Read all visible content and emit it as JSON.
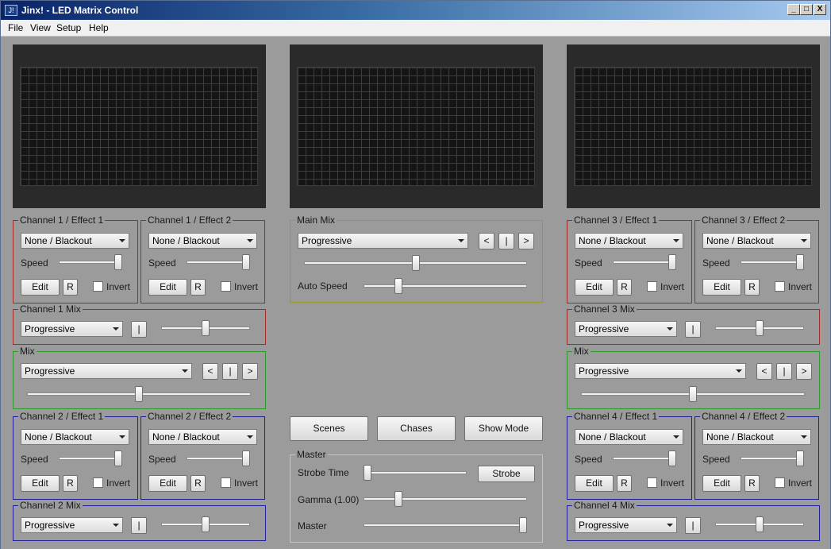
{
  "window": {
    "title": "Jinx! - LED Matrix Control",
    "icon": "J!",
    "minimize": "_",
    "maximize": "□",
    "close": "X"
  },
  "menu": [
    "File",
    "View",
    "Setup",
    "Help"
  ],
  "colors": {
    "channel1": "#a52a2a",
    "channel3": "#a52a2a",
    "mix": "#2f9a2f",
    "channel2": "#1f1f9a",
    "channel4": "#1f1f9a",
    "main_mix": "#9a9a2a",
    "master": "#c4c4c4"
  },
  "labels": {
    "speed": "Speed",
    "edit": "Edit",
    "r": "R",
    "invert": "Invert",
    "pause": "|",
    "prev": "<",
    "next": ">"
  },
  "effects": {
    "ch1e1": {
      "title": "Channel 1 / Effect 1",
      "value": "None / Blackout",
      "speed": 1.0,
      "invert": false
    },
    "ch1e2": {
      "title": "Channel 1 / Effect 2",
      "value": "None / Blackout",
      "speed": 1.0,
      "invert": false
    },
    "ch2e1": {
      "title": "Channel 2 / Effect 1",
      "value": "None / Blackout",
      "speed": 1.0,
      "invert": false
    },
    "ch2e2": {
      "title": "Channel 2 / Effect 2",
      "value": "None / Blackout",
      "speed": 1.0,
      "invert": false
    },
    "ch3e1": {
      "title": "Channel 3 / Effect 1",
      "value": "None / Blackout",
      "speed": 1.0,
      "invert": false
    },
    "ch3e2": {
      "title": "Channel 3 / Effect 2",
      "value": "None / Blackout",
      "speed": 1.0,
      "invert": false
    },
    "ch4e1": {
      "title": "Channel 4 / Effect 1",
      "value": "None / Blackout",
      "speed": 1.0,
      "invert": false
    },
    "ch4e2": {
      "title": "Channel 4 / Effect 2",
      "value": "None / Blackout",
      "speed": 1.0,
      "invert": false
    }
  },
  "channel_mix": {
    "ch1": {
      "title": "Channel 1 Mix",
      "value": "Progressive",
      "level": 0.5
    },
    "ch2": {
      "title": "Channel 2 Mix",
      "value": "Progressive",
      "level": 0.5
    },
    "ch3": {
      "title": "Channel 3 Mix",
      "value": "Progressive",
      "level": 0.5
    },
    "ch4": {
      "title": "Channel 4 Mix",
      "value": "Progressive",
      "level": 0.5
    }
  },
  "mix_left": {
    "title": "Mix",
    "value": "Progressive",
    "level": 0.5
  },
  "mix_right": {
    "title": "Mix",
    "value": "Progressive",
    "level": 0.5
  },
  "main_mix": {
    "title": "Main Mix",
    "value": "Progressive",
    "level": 0.5,
    "auto_speed_label": "Auto Speed",
    "auto_speed": 0.2
  },
  "buttons": {
    "scenes": "Scenes",
    "chases": "Chases",
    "show_mode": "Show Mode"
  },
  "master": {
    "title": "Master",
    "strobe_time_label": "Strobe Time",
    "strobe_time": 0.0,
    "strobe_button": "Strobe",
    "gamma_label": "Gamma (1.00)",
    "gamma": 0.2,
    "master_label": "Master",
    "master": 1.0
  }
}
